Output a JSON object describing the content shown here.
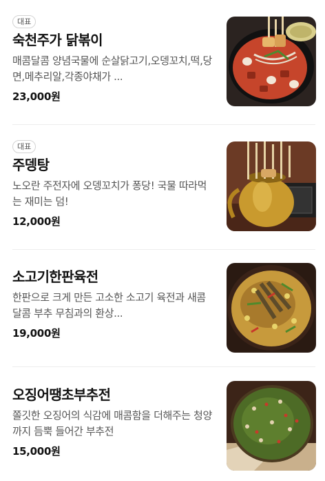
{
  "menu": {
    "items": [
      {
        "badge": "대표",
        "name": "숙천주가 닭볶이",
        "description": "매콤달콤 양념국물에 순살닭고기,오뎅꼬치,떡,당면,메추리알,각종야채가 ...",
        "price": "23,000원",
        "image_icon": "dakbokki-photo"
      },
      {
        "badge": "대표",
        "name": "주뎅탕",
        "description": "노오란 주전자에 오뎅꼬치가 퐁당! 국물 따라먹는 재미는 덤!",
        "price": "12,000원",
        "image_icon": "odeng-soup-kettle-photo"
      },
      {
        "badge": "",
        "name": "소고기한판육전",
        "description": "한판으로 크게 만든 고소한 소고기 육전과 새콤달콤 부추 무침과의 환상...",
        "price": "19,000원",
        "image_icon": "beef-pancake-photo"
      },
      {
        "badge": "",
        "name": "오징어땡초부추전",
        "description": "쫄깃한 오징어의 식감에 매콤함을 더해주는 청양까지 듬뿍 들어간 부추전",
        "price": "15,000원",
        "image_icon": "squid-chive-pancake-photo"
      }
    ]
  }
}
